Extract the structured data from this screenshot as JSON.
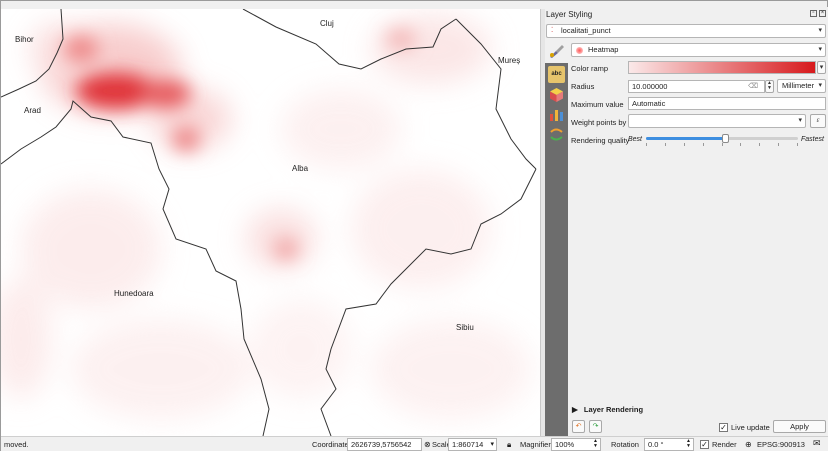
{
  "map": {
    "labels": {
      "bihor": "Bihor",
      "cluj": "Cluj",
      "mures": "Mureș",
      "arad": "Arad",
      "alba": "Alba",
      "hunedoara": "Hunedoara",
      "sibiu": "Sibiu"
    }
  },
  "panel": {
    "title": "Layer Styling",
    "layer_name": "localitati_punct",
    "renderer": "Heatmap",
    "color_ramp_label": "Color ramp",
    "radius_label": "Radius",
    "radius_value": "10.000000",
    "radius_unit": "Millimeter",
    "max_value_label": "Maximum value",
    "max_value": "Automatic",
    "weight_label": "Weight points by",
    "weight_value": "",
    "quality_label": "Rendering quality",
    "quality_best": "Best",
    "quality_fastest": "Fastest",
    "quality_level": 0.52,
    "layer_rendering": "Layer Rendering",
    "live_update_label": "Live update",
    "live_update_checked": true,
    "apply_label": "Apply",
    "ramp_colors": [
      "#fbe9e9",
      "#d7191c"
    ]
  },
  "statusbar": {
    "message": "moved.",
    "coordinate_label": "Coordinate",
    "coordinate_value": "2626739,5756542",
    "scale_label": "Scale",
    "scale_value": "1:860714",
    "magnifier_label": "Magnifier",
    "magnifier_value": "100%",
    "rotation_label": "Rotation",
    "rotation_value": "0.0 °",
    "render_label": "Render",
    "render_checked": true,
    "crs": "EPSG:900913"
  },
  "icons": [
    "paint-brush-icon",
    "labels-icon",
    "3d-view-icon",
    "diagram-icon",
    "history-icon",
    "undo-icon",
    "redo-icon",
    "lock-icon",
    "crs-globe-icon",
    "messages-icon",
    "expression-icon",
    "clear-field-icon"
  ]
}
